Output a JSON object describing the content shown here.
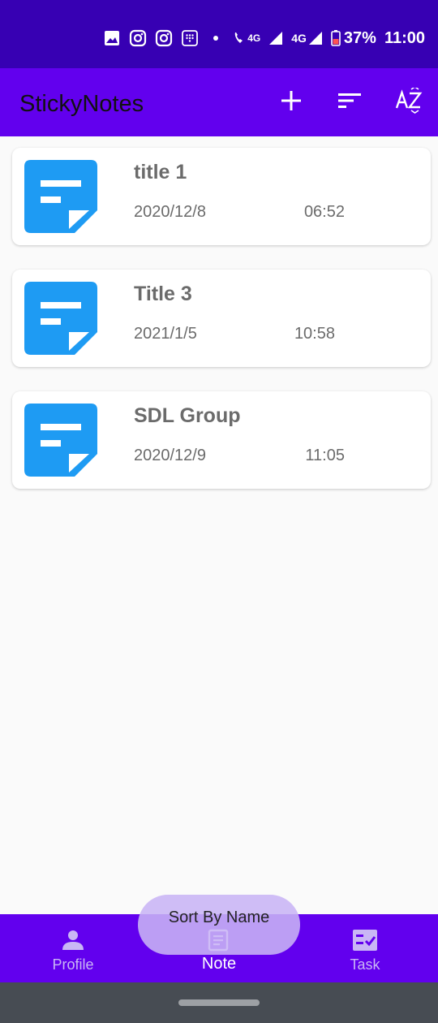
{
  "status_bar": {
    "net1": "4G",
    "net2": "4G",
    "battery": "37%",
    "time": "11:00",
    "colors": {
      "background": "#3700b3",
      "battery_low": "#ff5252"
    }
  },
  "app_bar": {
    "title": "StickyNotes",
    "actions": [
      "add-icon",
      "sort-icon",
      "sort-az-icon"
    ],
    "colors": {
      "background": "#6200ee",
      "title": "#111111"
    }
  },
  "notes": [
    {
      "title": "title 1",
      "date": "2020/12/8",
      "time": "06:52"
    },
    {
      "title": "Title 3",
      "date": "2021/1/5",
      "time": "10:58"
    },
    {
      "title": "SDL Group",
      "date": "2020/12/9",
      "time": "11:05"
    }
  ],
  "note_icon": {
    "name": "note-icon",
    "color": "#1e9bf3"
  },
  "bottom_nav": {
    "items": [
      {
        "label": "Profile",
        "icon": "person-icon",
        "active": false
      },
      {
        "label": "Note",
        "icon": "note-icon",
        "active": true
      },
      {
        "label": "Task",
        "icon": "task-icon",
        "active": false
      }
    ],
    "colors": {
      "background": "#6200ee",
      "active": "#ffffff",
      "inactive": "#c9b6f5"
    }
  },
  "toast": {
    "text": "Sort By Name"
  }
}
